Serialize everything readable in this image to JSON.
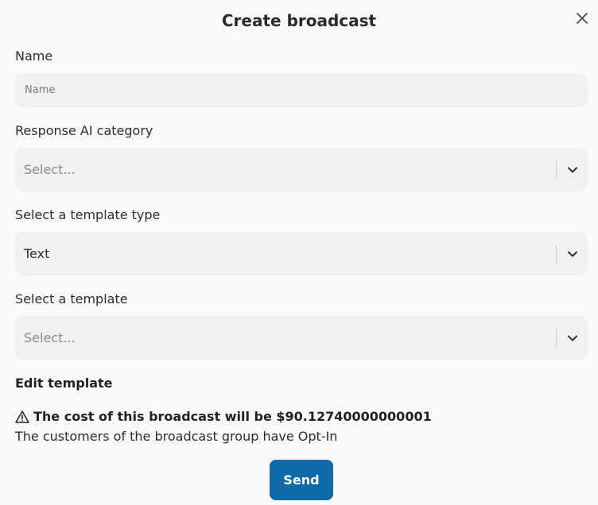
{
  "modal": {
    "title": "Create broadcast",
    "close_icon": "close-icon"
  },
  "fields": {
    "name": {
      "label": "Name",
      "placeholder": "Name",
      "value": ""
    },
    "ai_category": {
      "label": "Response AI category",
      "value": "Select..."
    },
    "template_type": {
      "label": "Select a template type",
      "value": "Text"
    },
    "template": {
      "label": "Select a template",
      "value": "Select..."
    }
  },
  "edit_template": {
    "title": "Edit template"
  },
  "cost_notice": {
    "icon": "warning-icon",
    "text": "The cost of this broadcast will be $90.12740000000001",
    "optin_text": "The customers of the broadcast group have Opt-In"
  },
  "actions": {
    "send_label": "Send"
  },
  "colors": {
    "background": "#fafafa",
    "field_bg": "#f1f1f1",
    "primary_button": "#0f6aa8"
  }
}
